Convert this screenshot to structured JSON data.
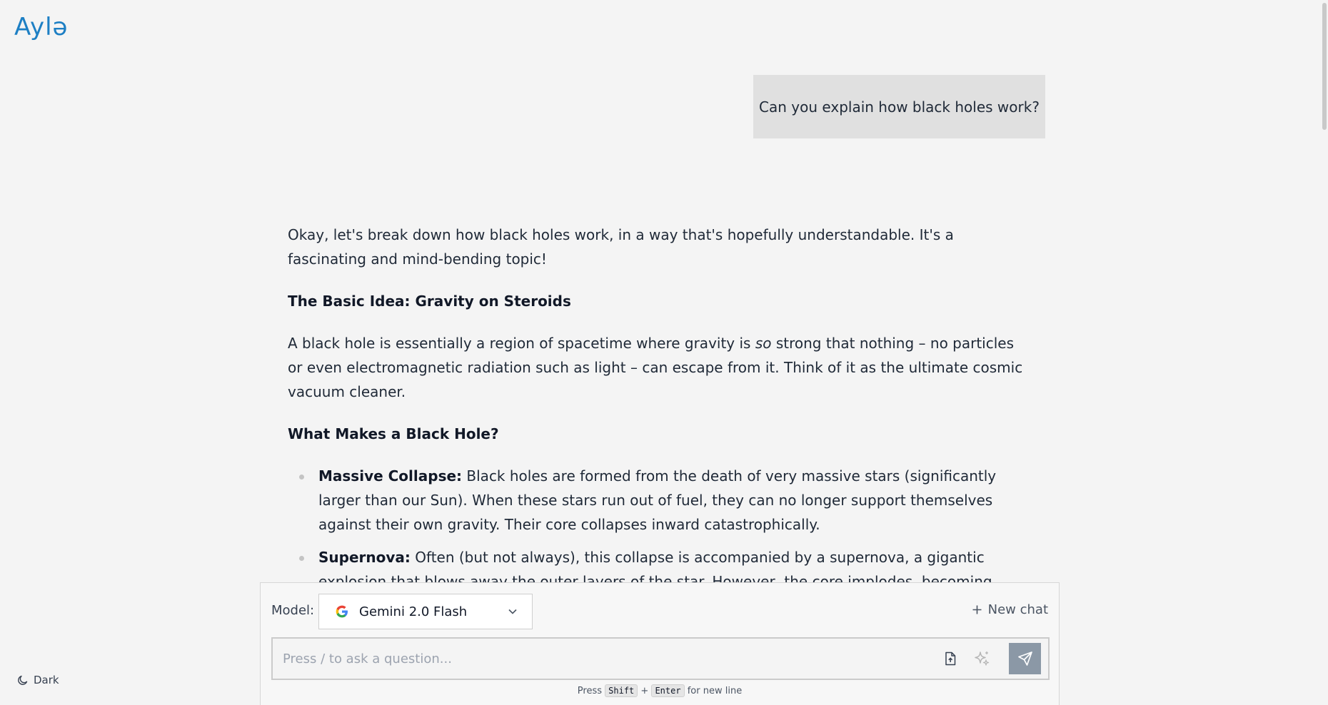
{
  "app": {
    "logo_text": "Aylə",
    "accent_color": "#1d7fc4"
  },
  "conversation": {
    "user_message": "Can you explain how black holes work?",
    "answer": {
      "intro": "Okay, let's break down how black holes work, in a way that's hopefully understandable.  It's a fascinating and mind-bending topic!",
      "heading1": "The Basic Idea: Gravity on Steroids",
      "para1_before": "A black hole is essentially a region of spacetime where gravity is ",
      "para1_em": "so",
      "para1_after": " strong that nothing – no particles or even electromagnetic radiation such as light – can escape from it.  Think of it as the ultimate cosmic vacuum cleaner.",
      "heading2": "What Makes a Black Hole?",
      "bullets": [
        {
          "term": "Massive Collapse:",
          "text": " Black holes are formed from the death of very massive stars (significantly larger than our Sun). When these stars run out of fuel, they can no longer support themselves against their own grav­ity. Their core collapses inward catastrophically."
        },
        {
          "term": "Supernova:",
          "text": " Often (but not always), this collapse is accompanied by a supernova, a gigantic explosion that blows away the outer layers of the star. However, the core implodes, becoming incredibly dense."
        }
      ]
    }
  },
  "composer": {
    "model_label": "Model:",
    "model_selected": "Gemini 2.0 Flash",
    "new_chat_label": "New chat",
    "input_placeholder": "Press / to ask a question...",
    "hint_press": "Press",
    "hint_key1": "Shift",
    "hint_plus": "+",
    "hint_key2": "Enter",
    "hint_suffix": "for new line",
    "send_color": "#8b98a6"
  },
  "theme_toggle": {
    "label": "Dark",
    "icon": "moon-icon"
  }
}
